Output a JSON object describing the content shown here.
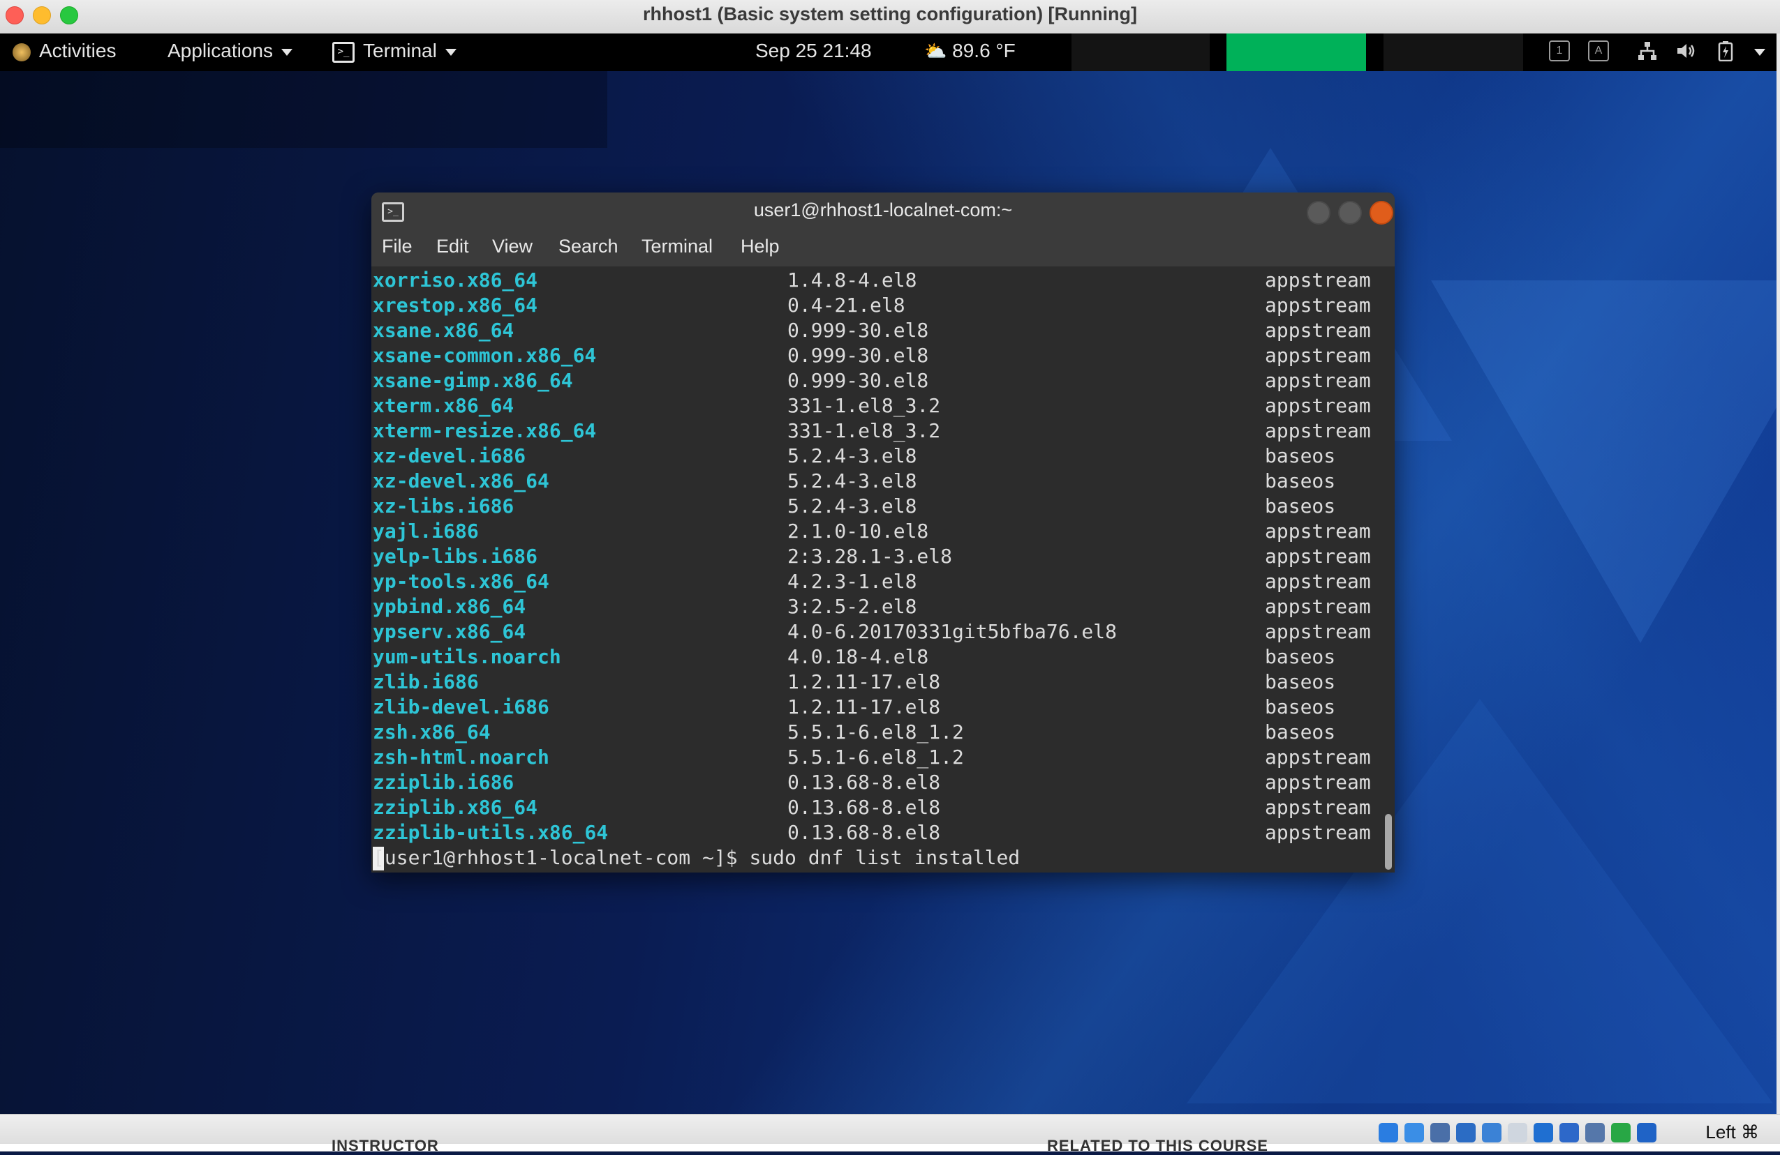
{
  "host_window": {
    "title": "rhhost1 (Basic system setting configuration) [Running]"
  },
  "topbar": {
    "activities": "Activities",
    "applications": "Applications",
    "terminal_menu": "Terminal",
    "datetime": "Sep 25  21:48",
    "weather": "89.6 °F",
    "weather_icon": "weather-sun-cloud-icon",
    "tray": {
      "ws1": "1",
      "ws2": "A"
    }
  },
  "terminal": {
    "title": "user1@rhhost1-localnet-com:~",
    "menu": [
      "File",
      "Edit",
      "View",
      "Search",
      "Terminal",
      "Help"
    ],
    "rows": [
      [
        "xorriso.x86_64",
        "1.4.8-4.el8",
        "appstream"
      ],
      [
        "xrestop.x86_64",
        "0.4-21.el8",
        "appstream"
      ],
      [
        "xsane.x86_64",
        "0.999-30.el8",
        "appstream"
      ],
      [
        "xsane-common.x86_64",
        "0.999-30.el8",
        "appstream"
      ],
      [
        "xsane-gimp.x86_64",
        "0.999-30.el8",
        "appstream"
      ],
      [
        "xterm.x86_64",
        "331-1.el8_3.2",
        "appstream"
      ],
      [
        "xterm-resize.x86_64",
        "331-1.el8_3.2",
        "appstream"
      ],
      [
        "xz-devel.i686",
        "5.2.4-3.el8",
        "baseos"
      ],
      [
        "xz-devel.x86_64",
        "5.2.4-3.el8",
        "baseos"
      ],
      [
        "xz-libs.i686",
        "5.2.4-3.el8",
        "baseos"
      ],
      [
        "yajl.i686",
        "2.1.0-10.el8",
        "appstream"
      ],
      [
        "yelp-libs.i686",
        "2:3.28.1-3.el8",
        "appstream"
      ],
      [
        "yp-tools.x86_64",
        "4.2.3-1.el8",
        "appstream"
      ],
      [
        "ypbind.x86_64",
        "3:2.5-2.el8",
        "appstream"
      ],
      [
        "ypserv.x86_64",
        "4.0-6.20170331git5bfba76.el8",
        "appstream"
      ],
      [
        "yum-utils.noarch",
        "4.0.18-4.el8",
        "baseos"
      ],
      [
        "zlib.i686",
        "1.2.11-17.el8",
        "baseos"
      ],
      [
        "zlib-devel.i686",
        "1.2.11-17.el8",
        "baseos"
      ],
      [
        "zsh.x86_64",
        "5.5.1-6.el8_1.2",
        "baseos"
      ],
      [
        "zsh-html.noarch",
        "5.5.1-6.el8_1.2",
        "appstream"
      ],
      [
        "zziplib.i686",
        "0.13.68-8.el8",
        "appstream"
      ],
      [
        "zziplib.x86_64",
        "0.13.68-8.el8",
        "appstream"
      ],
      [
        "zziplib-utils.x86_64",
        "0.13.68-8.el8",
        "appstream"
      ]
    ],
    "prompt": "[user1@rhhost1-localnet-com ~]$ sudo dnf list installed"
  },
  "statusbar": {
    "host_key": "Left ⌘",
    "icons": [
      "hard-disk-icon",
      "optical-drive-icon",
      "audio-icon",
      "network-icon",
      "usb-icon",
      "shared-folder-icon",
      "display-icon",
      "recording-icon",
      "cpu-icon",
      "mouse-integration-icon",
      "arrow-down-icon"
    ]
  },
  "below": {
    "left": "INSTRUCTOR",
    "right": "RELATED TO THIS COURSE"
  },
  "colors": {
    "package_name": "#2ec5d6",
    "close_button": "#e05d1b",
    "gnome_bar": "#000000"
  }
}
